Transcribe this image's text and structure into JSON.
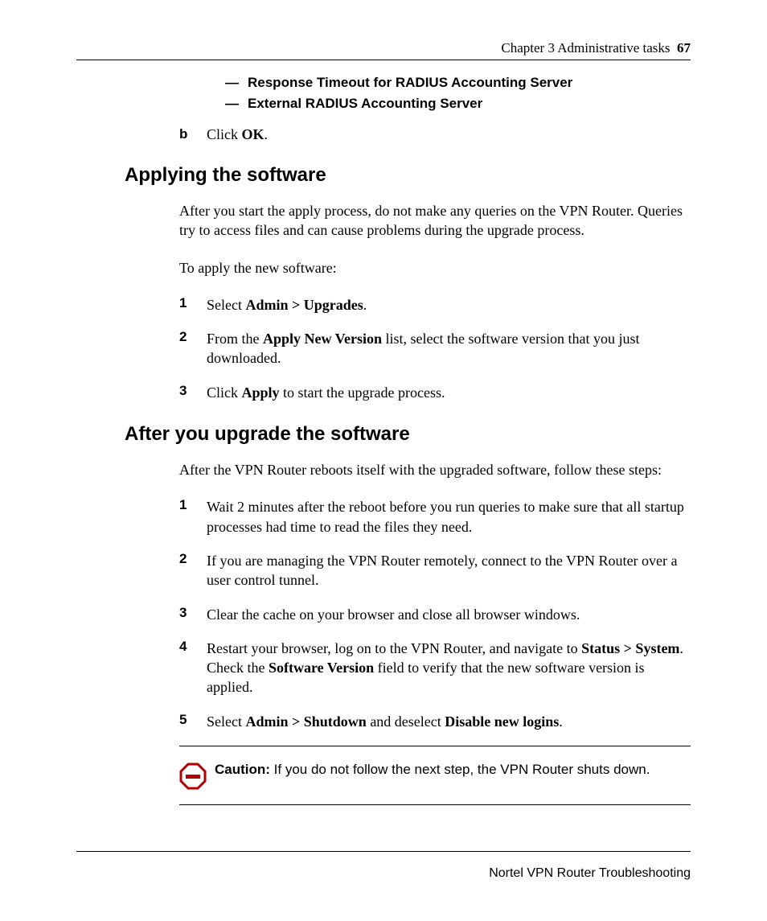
{
  "header": {
    "chapter": "Chapter 3  Administrative tasks",
    "page_number": "67"
  },
  "top_dashes": {
    "d1": "Response Timeout for RADIUS Accounting Server",
    "d2": "External RADIUS Accounting Server"
  },
  "step_b": {
    "marker": "b",
    "pre": "Click ",
    "bold": "OK",
    "post": "."
  },
  "section1": {
    "title": "Applying the software",
    "para1": "After you start the apply process, do not make any queries on the VPN Router. Queries try to access files and can cause problems during the upgrade process.",
    "para2": "To apply the new software:",
    "steps": {
      "s1": {
        "num": "1",
        "pre": "Select ",
        "b1": "Admin > Upgrades",
        "post": "."
      },
      "s2": {
        "num": "2",
        "pre": "From the ",
        "b1": "Apply New Version",
        "mid": " list, select the software version that you just downloaded."
      },
      "s3": {
        "num": "3",
        "pre": "Click ",
        "b1": "Apply",
        "post": " to start the upgrade process."
      }
    }
  },
  "section2": {
    "title": "After you upgrade the software",
    "para1": "After the VPN Router reboots itself with the upgraded software, follow these steps:",
    "steps": {
      "s1": {
        "num": "1",
        "txt": "Wait 2 minutes after the reboot before you run queries to make sure that all startup processes had time to read the files they need."
      },
      "s2": {
        "num": "2",
        "txt": "If you are managing the VPN Router remotely, connect to the VPN Router over a user control tunnel."
      },
      "s3": {
        "num": "3",
        "txt": "Clear the cache on your browser and close all browser windows."
      },
      "s4": {
        "num": "4",
        "pre": "Restart your browser, log on to the VPN Router, and navigate to ",
        "b1": "Status > System",
        "mid": ". Check the ",
        "b2": "Software Version",
        "post": " field to verify that the new software version is applied."
      },
      "s5": {
        "num": "5",
        "pre": "Select ",
        "b1": "Admin > Shutdown",
        "mid": " and deselect ",
        "b2": "Disable new logins",
        "post": "."
      }
    }
  },
  "caution": {
    "label": "Caution:",
    "text": " If you do not follow the next step, the VPN Router shuts down."
  },
  "footer": {
    "text": "Nortel VPN Router Troubleshooting"
  }
}
